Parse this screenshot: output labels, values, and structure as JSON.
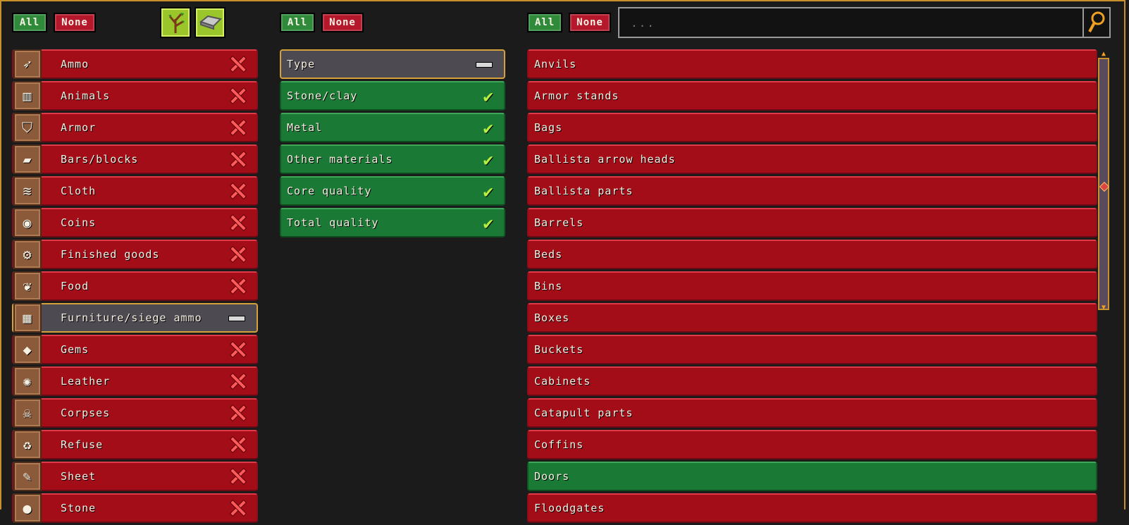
{
  "toolbar": {
    "left": {
      "all": "All",
      "none": "None"
    },
    "middle": {
      "all": "All",
      "none": "None"
    },
    "right": {
      "all": "All",
      "none": "None"
    },
    "filter_icons": [
      "plant-icon",
      "bar-icon"
    ],
    "search_placeholder": "..."
  },
  "categories": [
    {
      "label": "Ammo",
      "icon": "ammo-icon",
      "state": "off"
    },
    {
      "label": "Animals",
      "icon": "cage-icon",
      "state": "off"
    },
    {
      "label": "Armor",
      "icon": "shield-icon",
      "state": "off"
    },
    {
      "label": "Bars/blocks",
      "icon": "bar-icon",
      "state": "off"
    },
    {
      "label": "Cloth",
      "icon": "cloth-icon",
      "state": "off"
    },
    {
      "label": "Coins",
      "icon": "coins-icon",
      "state": "off"
    },
    {
      "label": "Finished goods",
      "icon": "goods-icon",
      "state": "off"
    },
    {
      "label": "Food",
      "icon": "food-icon",
      "state": "off"
    },
    {
      "label": "Furniture/siege ammo",
      "icon": "furniture-icon",
      "state": "partial"
    },
    {
      "label": "Gems",
      "icon": "gem-icon",
      "state": "off"
    },
    {
      "label": "Leather",
      "icon": "leather-icon",
      "state": "off"
    },
    {
      "label": "Corpses",
      "icon": "skull-icon",
      "state": "off"
    },
    {
      "label": "Refuse",
      "icon": "trash-icon",
      "state": "off"
    },
    {
      "label": "Sheet",
      "icon": "scroll-icon",
      "state": "off"
    },
    {
      "label": "Stone",
      "icon": "stone-icon",
      "state": "off"
    }
  ],
  "subcategories": [
    {
      "label": "Type",
      "state": "partial"
    },
    {
      "label": "Stone/clay",
      "state": "on"
    },
    {
      "label": "Metal",
      "state": "on"
    },
    {
      "label": "Other materials",
      "state": "on"
    },
    {
      "label": "Core quality",
      "state": "on"
    },
    {
      "label": "Total quality",
      "state": "on"
    }
  ],
  "items": [
    {
      "label": "Anvils",
      "state": "off"
    },
    {
      "label": "Armor stands",
      "state": "off"
    },
    {
      "label": "Bags",
      "state": "off"
    },
    {
      "label": "Ballista arrow heads",
      "state": "off"
    },
    {
      "label": "Ballista parts",
      "state": "off"
    },
    {
      "label": "Barrels",
      "state": "off"
    },
    {
      "label": "Beds",
      "state": "off"
    },
    {
      "label": "Bins",
      "state": "off"
    },
    {
      "label": "Boxes",
      "state": "off"
    },
    {
      "label": "Buckets",
      "state": "off"
    },
    {
      "label": "Cabinets",
      "state": "off"
    },
    {
      "label": "Catapult parts",
      "state": "off"
    },
    {
      "label": "Coffins",
      "state": "off"
    },
    {
      "label": "Doors",
      "state": "on"
    },
    {
      "label": "Floodgates",
      "state": "off"
    }
  ],
  "colors": {
    "off": "#a30d18",
    "on": "#1a7a35",
    "partial": "#4e4a52",
    "accent": "#c8902a"
  }
}
